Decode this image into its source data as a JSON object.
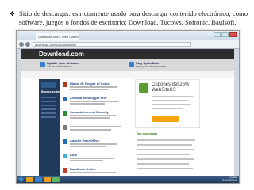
{
  "slide": {
    "bullet_symbol": "❖",
    "text": "Sitio de descargas: estrictamente usado para descargar contenido electrónico, como software, juegos o fondos de escritorio: Download, Tucows, Softonic, Baulsoft."
  },
  "browser": {
    "tab_title": "Download.com - Free Downl...",
    "url": "download.cnet.com/windows/"
  },
  "site": {
    "logo": "Download",
    "logo_suffix": ".com",
    "promos": [
      {
        "title": "Update Your Software",
        "desc": "Get the latest versions"
      },
      {
        "title": "Stay Up to Date",
        "desc": "Keep your software current"
      }
    ],
    "sidebar_title": "Browse software",
    "list_items": [
      {
        "title": "Diablo III: Reaper of Souls",
        "icon_color": "#b33a1e"
      },
      {
        "title": "Zemana AntiLogger Free",
        "icon_color": "#2f6fb5"
      },
      {
        "title": "Comodo Internet Security",
        "icon_color": "#2c8a3a"
      },
      {
        "title": "",
        "icon_color": "#7a7a7a"
      },
      {
        "title": "Apache OpenOffice",
        "icon_color": "#1f6fb3"
      },
      {
        "title": "Kodi",
        "icon_color": "#3db0e0"
      },
      {
        "title": "Bandicam Online",
        "icon_color": "#c23b22"
      }
    ],
    "coupon_title": "Cupones del 25%",
    "coupon_subtitle": "WebSiteKS",
    "dl_title": "Top downloads"
  },
  "taskbar": {
    "time": "11:53",
    "date": "04/10/2014",
    "icon_colors": [
      "#e8a21a",
      "#3b7fd0",
      "#f29d17",
      "#5cb85c"
    ]
  }
}
